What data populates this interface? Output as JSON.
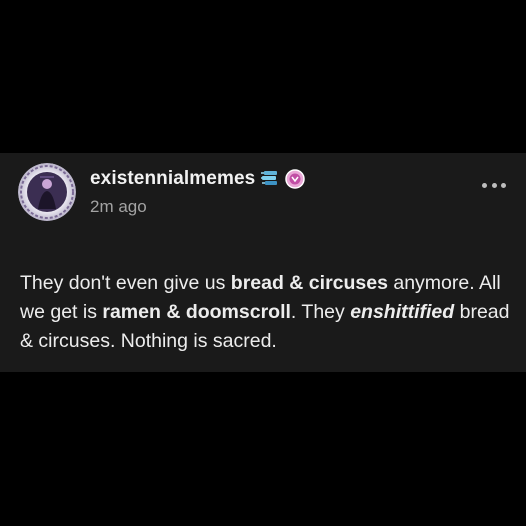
{
  "post": {
    "username": "existennialmemes",
    "timestamp": "2m ago",
    "badges": [
      "blue-stack-badge-icon",
      "pink-flower-badge-icon"
    ],
    "more_icon": "more-options-icon",
    "body": {
      "seg1": "They don't even give us ",
      "bold1": "bread & circuses",
      "seg2": " anymore. All we get is ",
      "bold2": "ramen & doomscroll",
      "seg3": ". They ",
      "italic1": "enshittified",
      "seg4": " bread & circuses. Nothing is sacred."
    }
  },
  "colors": {
    "page_bg": "#000000",
    "post_bg": "#1a1a1a",
    "text": "#ededed",
    "muted": "#a3a3a3"
  }
}
